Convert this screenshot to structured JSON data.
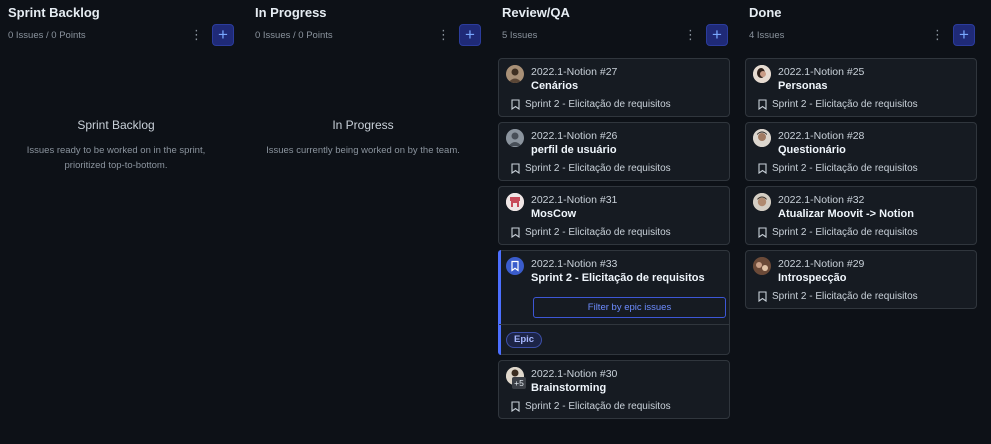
{
  "columns": [
    {
      "title": "Sprint Backlog",
      "meta": "0 Issues / 0 Points",
      "empty_title": "Sprint Backlog",
      "empty_desc": "Issues ready to be worked on in the sprint, prioritized top-to-bottom."
    },
    {
      "title": "In Progress",
      "meta": "0 Issues / 0 Points",
      "empty_title": "In Progress",
      "empty_desc": "Issues currently being worked on by the team."
    },
    {
      "title": "Review/QA",
      "meta": "5 Issues",
      "cards": [
        {
          "num": "2022.1-Notion #27",
          "title": "Cenários",
          "sprint": "Sprint 2 - Elicitação de requisitos"
        },
        {
          "num": "2022.1-Notion #26",
          "title": "perfil de usuário",
          "sprint": "Sprint 2 - Elicitação de requisitos"
        },
        {
          "num": "2022.1-Notion #31",
          "title": "MosCow",
          "sprint": "Sprint 2 - Elicitação de requisitos"
        },
        {
          "num": "2022.1-Notion #33",
          "title": "Sprint 2 - Elicitação de requisitos",
          "filter_label": "Filter by epic issues",
          "badge": "Epic"
        },
        {
          "num": "2022.1-Notion #30",
          "title": "Brainstorming",
          "sprint": "Sprint 2 - Elicitação de requisitos",
          "extra_assignees": "+5"
        }
      ]
    },
    {
      "title": "Done",
      "meta": "4 Issues",
      "cards": [
        {
          "num": "2022.1-Notion #25",
          "title": "Personas",
          "sprint": "Sprint 2 - Elicitação de requisitos"
        },
        {
          "num": "2022.1-Notion #28",
          "title": "Questionário",
          "sprint": "Sprint 2 - Elicitação de requisitos"
        },
        {
          "num": "2022.1-Notion #32",
          "title": "Atualizar Moovit -> Notion",
          "sprint": "Sprint 2 - Elicitação de requisitos"
        },
        {
          "num": "2022.1-Notion #29",
          "title": "Introspecção",
          "sprint": "Sprint 2 - Elicitação de requisitos"
        }
      ]
    }
  ],
  "icons": {
    "kebab": "⋮",
    "add": "+"
  },
  "colors": {
    "background": "#0d1117",
    "card": "#161b22",
    "accent": "#4c6fff"
  }
}
